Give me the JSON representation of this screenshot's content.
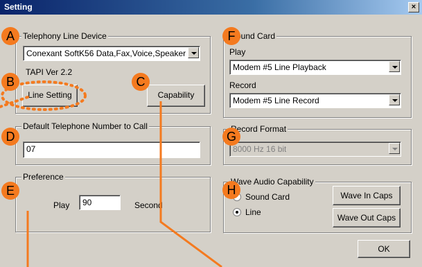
{
  "window": {
    "title": "Setting",
    "close_label": "×"
  },
  "telephony": {
    "legend": "Telephony Line Device",
    "device_value": "Conexant SoftK56 Data,Fax,Voice,Speaker",
    "tapi_version": "TAPI Ver 2.2",
    "line_setting_label": "Line Setting",
    "capability_label": "Capability"
  },
  "default_number": {
    "legend": "Default Telephone Number to Call",
    "value": "07"
  },
  "preference": {
    "legend": "Preference",
    "play_label": "Play",
    "play_value": "90",
    "unit_label": "Second"
  },
  "sound_card": {
    "legend": "Sound Card",
    "play_label": "Play",
    "play_value": "Modem #5 Line Playback",
    "record_label": "Record",
    "record_value": "Modem #5 Line Record"
  },
  "record_format": {
    "legend": "Record Format",
    "value": "8000 Hz 16 bit"
  },
  "wave_audio": {
    "legend": "Wave Audio Capability",
    "option_sound_card": "Sound Card",
    "option_line": "Line",
    "selected": "Line",
    "wave_in_label": "Wave In Caps",
    "wave_out_label": "Wave Out Caps"
  },
  "ok_label": "OK",
  "markers": [
    "A",
    "B",
    "C",
    "D",
    "E",
    "F",
    "G",
    "H"
  ],
  "colors": {
    "marker": "#f47a1f",
    "titlebar": "#0a246a",
    "dialog": "#d4d0c8"
  }
}
